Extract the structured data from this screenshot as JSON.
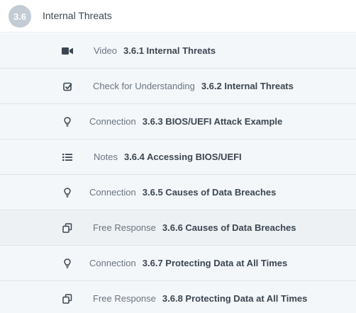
{
  "section": {
    "number": "3.6",
    "title": "Internal Threats"
  },
  "lessons": [
    {
      "type": "Video",
      "name": "3.6.1 Internal Threats",
      "icon": "video-camera-icon"
    },
    {
      "type": "Check for Understanding",
      "name": "3.6.2 Internal Threats",
      "icon": "checkbox-icon"
    },
    {
      "type": "Connection",
      "name": "3.6.3 BIOS/UEFI Attack Example",
      "icon": "lightbulb-icon"
    },
    {
      "type": "Notes",
      "name": "3.6.4 Accessing BIOS/UEFI",
      "icon": "list-icon"
    },
    {
      "type": "Connection",
      "name": "3.6.5 Causes of Data Breaches",
      "icon": "lightbulb-icon"
    },
    {
      "type": "Free Response",
      "name": "3.6.6 Causes of Data Breaches",
      "icon": "copy-icon"
    },
    {
      "type": "Connection",
      "name": "3.6.7 Protecting Data at All Times",
      "icon": "lightbulb-icon"
    },
    {
      "type": "Free Response",
      "name": "3.6.8 Protecting Data at All Times",
      "icon": "copy-icon"
    }
  ]
}
